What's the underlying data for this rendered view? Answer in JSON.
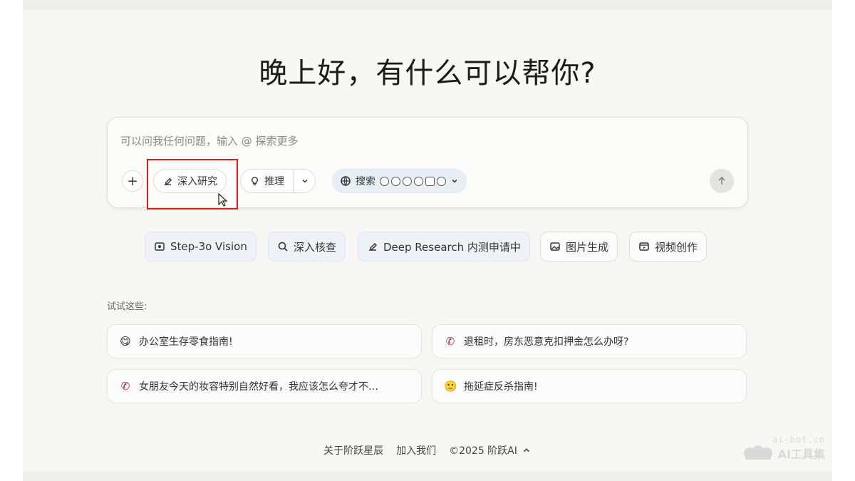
{
  "greeting": "晚上好，有什么可以帮你?",
  "composer": {
    "placeholder": "可以问我任何问题，输入 @ 探索更多",
    "add_label": "+",
    "deep_research_label": "深入研究",
    "reasoning_label": "推理",
    "search_label": "搜索"
  },
  "features": [
    {
      "label": "Step-3o Vision",
      "icon": "vision-icon"
    },
    {
      "label": "深入核查",
      "icon": "magnifier-icon"
    },
    {
      "label": "Deep Research 内测申请中",
      "icon": "research-icon"
    },
    {
      "label": "图片生成",
      "icon": "image-icon"
    },
    {
      "label": "视频创作",
      "icon": "video-icon"
    }
  ],
  "try_label": "试试这些:",
  "suggestions": [
    {
      "text": "办公室生存零食指南!",
      "icon": "face-emoji-icon"
    },
    {
      "text": "退租时，房东恶意克扣押金怎么办呀?",
      "icon": "phone-icon"
    },
    {
      "text": "女朋友今天的妆容特别自然好看，我应该怎么夸才不…",
      "icon": "phone-icon"
    },
    {
      "text": "拖延症反杀指南!",
      "icon": "face-emoji-icon"
    }
  ],
  "footer": {
    "about": "关于阶跃星辰",
    "join": "加入我们",
    "copyright": "©2025 阶跃AI"
  },
  "watermark": {
    "domain": "ai-bot.cn",
    "name": "AI工具集"
  },
  "colors": {
    "highlight": "#e01c1c",
    "background": "#f7f7f5",
    "search_pill_bg": "#e8eef6",
    "phone_icon": "#a8233a"
  }
}
